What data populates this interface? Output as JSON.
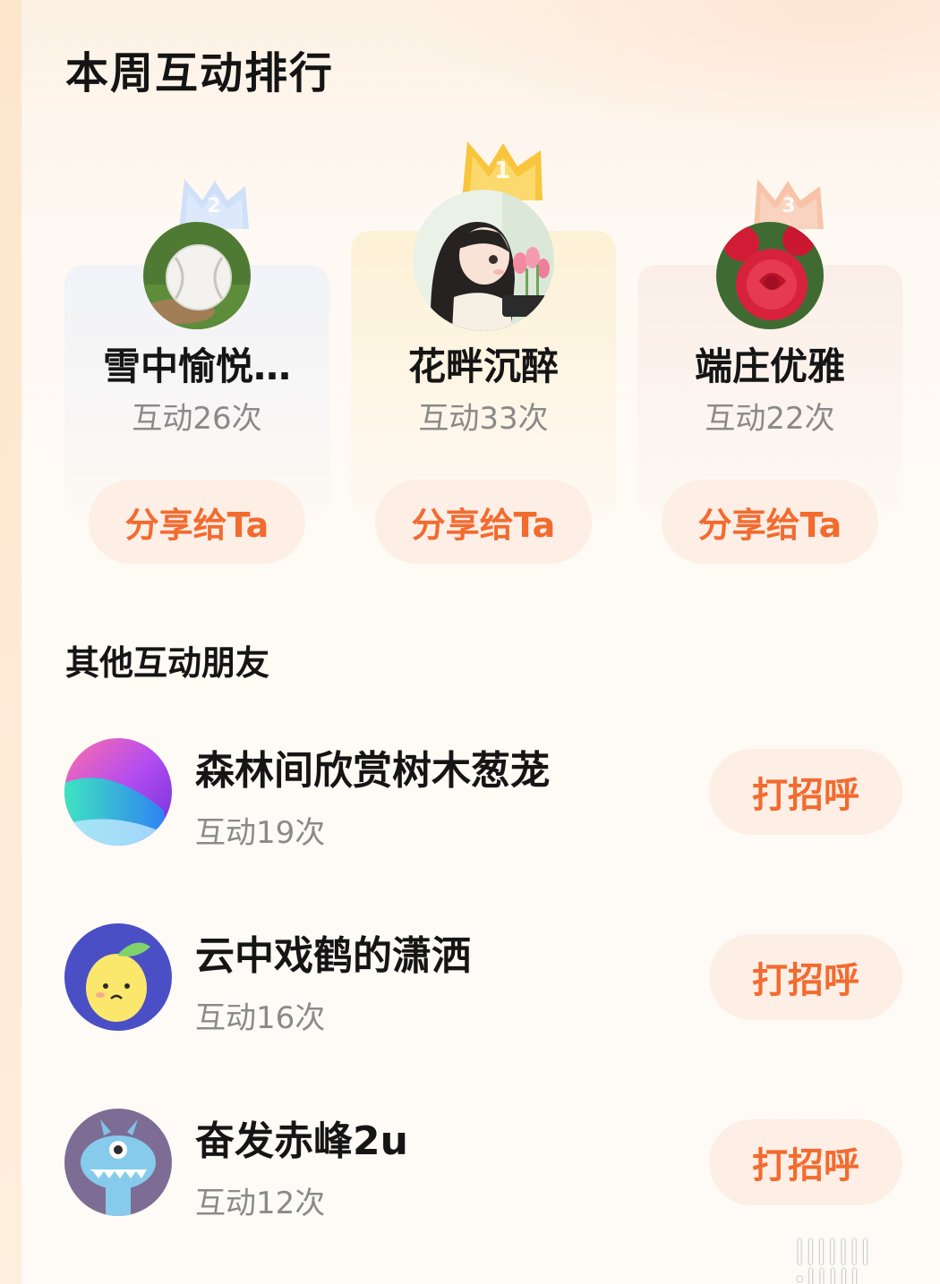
{
  "header": {
    "title": "本周互动排行"
  },
  "podium": [
    {
      "rank": "2",
      "name": "雪中愉悦…",
      "count": "互动26次",
      "share_label": "分享给Ta",
      "avatar_icon": "baseball-avatar",
      "crown_color": "#c9dcf8"
    },
    {
      "rank": "1",
      "name": "花畔沉醉",
      "count": "互动33次",
      "share_label": "分享给Ta",
      "avatar_icon": "girl-illustration-avatar",
      "crown_color": "#f9cd4e"
    },
    {
      "rank": "3",
      "name": "端庄优雅",
      "count": "互动22次",
      "share_label": "分享给Ta",
      "avatar_icon": "red-rose-avatar",
      "crown_color": "#f7c2a8"
    }
  ],
  "others": {
    "section_title": "其他互动朋友",
    "items": [
      {
        "name": "森林间欣赏树木葱茏",
        "count": "互动19次",
        "action_label": "打招呼",
        "avatar_icon": "gradient-wave-avatar"
      },
      {
        "name": "云中戏鹤的潇洒",
        "count": "互动16次",
        "action_label": "打招呼",
        "avatar_icon": "lemon-avatar"
      },
      {
        "name": "奋发赤峰2u",
        "count": "互动12次",
        "action_label": "打招呼",
        "avatar_icon": "monster-avatar"
      }
    ]
  },
  "watermark": {
    "text": "|||||||·|||||"
  },
  "colors": {
    "accent": "#f26b2f",
    "button_bg": "#fdeee6",
    "muted_text": "#8a8a8a"
  }
}
